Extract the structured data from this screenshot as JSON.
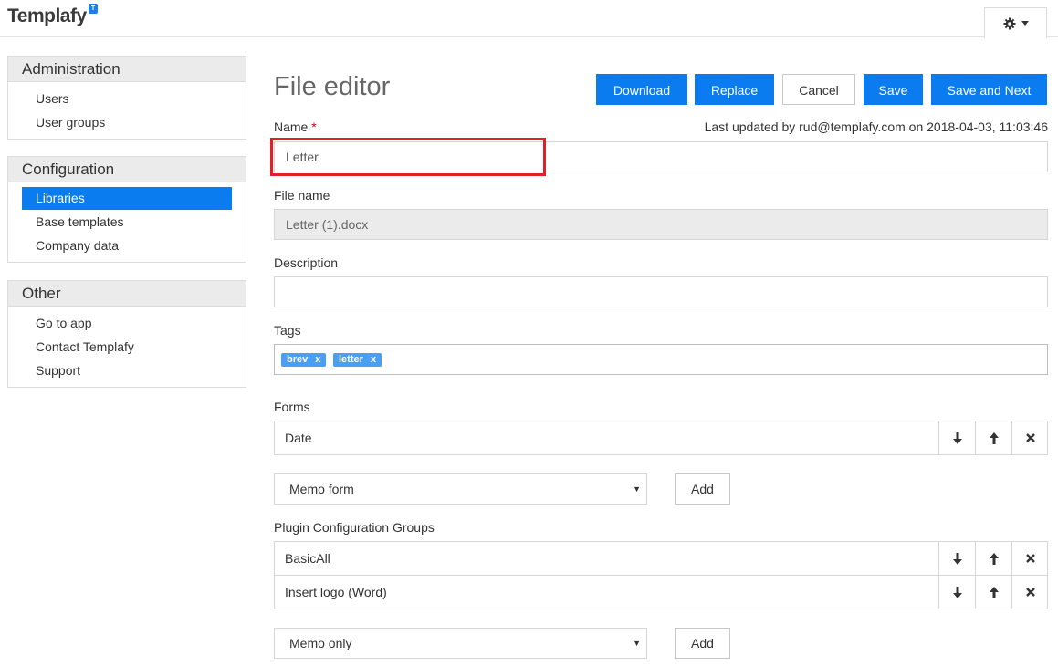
{
  "app": {
    "logo_text": "Templafy",
    "logo_badge": "T"
  },
  "header": {
    "settings_icon": "gear-icon",
    "settings_caret": "caret-down-icon"
  },
  "sidebar": {
    "administration": {
      "title": "Administration",
      "items": [
        "Users",
        "User groups"
      ]
    },
    "configuration": {
      "title": "Configuration",
      "items": [
        "Libraries",
        "Base templates",
        "Company data"
      ],
      "active": "Libraries"
    },
    "other": {
      "title": "Other",
      "items": [
        "Go to app",
        "Contact Templafy",
        "Support"
      ]
    }
  },
  "main": {
    "title": "File editor",
    "buttons": {
      "download": "Download",
      "replace": "Replace",
      "cancel": "Cancel",
      "save": "Save",
      "save_next": "Save and Next"
    },
    "name": {
      "label": "Name",
      "required_mark": "*",
      "value": "Letter"
    },
    "last_updated": "Last updated by rud@templafy.com on 2018-04-03, 11:03:46",
    "file_name": {
      "label": "File name",
      "value": "Letter (1).docx"
    },
    "description": {
      "label": "Description",
      "value": ""
    },
    "tags": {
      "label": "Tags",
      "items": [
        {
          "text": "brev",
          "remove": "x"
        },
        {
          "text": "letter",
          "remove": "x"
        }
      ]
    },
    "forms": {
      "label": "Forms",
      "rows": [
        "Date"
      ],
      "select_value": "Memo form",
      "add_label": "Add"
    },
    "plugin_groups": {
      "label": "Plugin Configuration Groups",
      "rows": [
        "BasicAll",
        "Insert logo (Word)"
      ],
      "select_value": "Memo only",
      "add_label": "Add"
    }
  },
  "colors": {
    "primary": "#0a7cf0",
    "highlight_border": "#e02027",
    "tag_bg": "#4a9ff5",
    "sidebar_header_bg": "#ebebeb"
  }
}
